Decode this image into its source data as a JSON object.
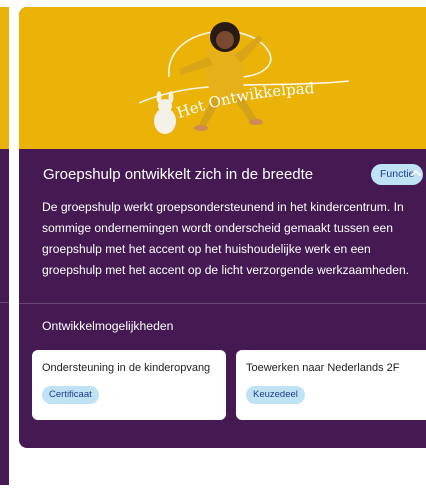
{
  "hero": {
    "image_label": "Het Ontwikkelpad"
  },
  "card": {
    "title": "Groepshulp ontwikkelt zich in de breedte",
    "type_badge": "Functie",
    "description": "De groepshulp werkt groepsondersteunend in het kindercentrum. In sommige ondernemingen wordt onderscheid gemaakt tussen een groepshulp met het accent op het huishoudelijke werk en een groepshulp met het accent op de licht verzorgende werkzaamheden."
  },
  "development": {
    "heading": "Ontwikkelmogelijkheden",
    "items": [
      {
        "title": "Ondersteuning in de kinderopvang",
        "badge": "Certificaat"
      },
      {
        "title": "Toewerken naar Nederlands 2F",
        "badge": "Keuzedeel"
      }
    ]
  },
  "colors": {
    "hero_yellow": "#EBB208",
    "card_purple": "#451A52",
    "badge_bg": "#BFE2F5",
    "badge_text": "#1D3F82"
  }
}
